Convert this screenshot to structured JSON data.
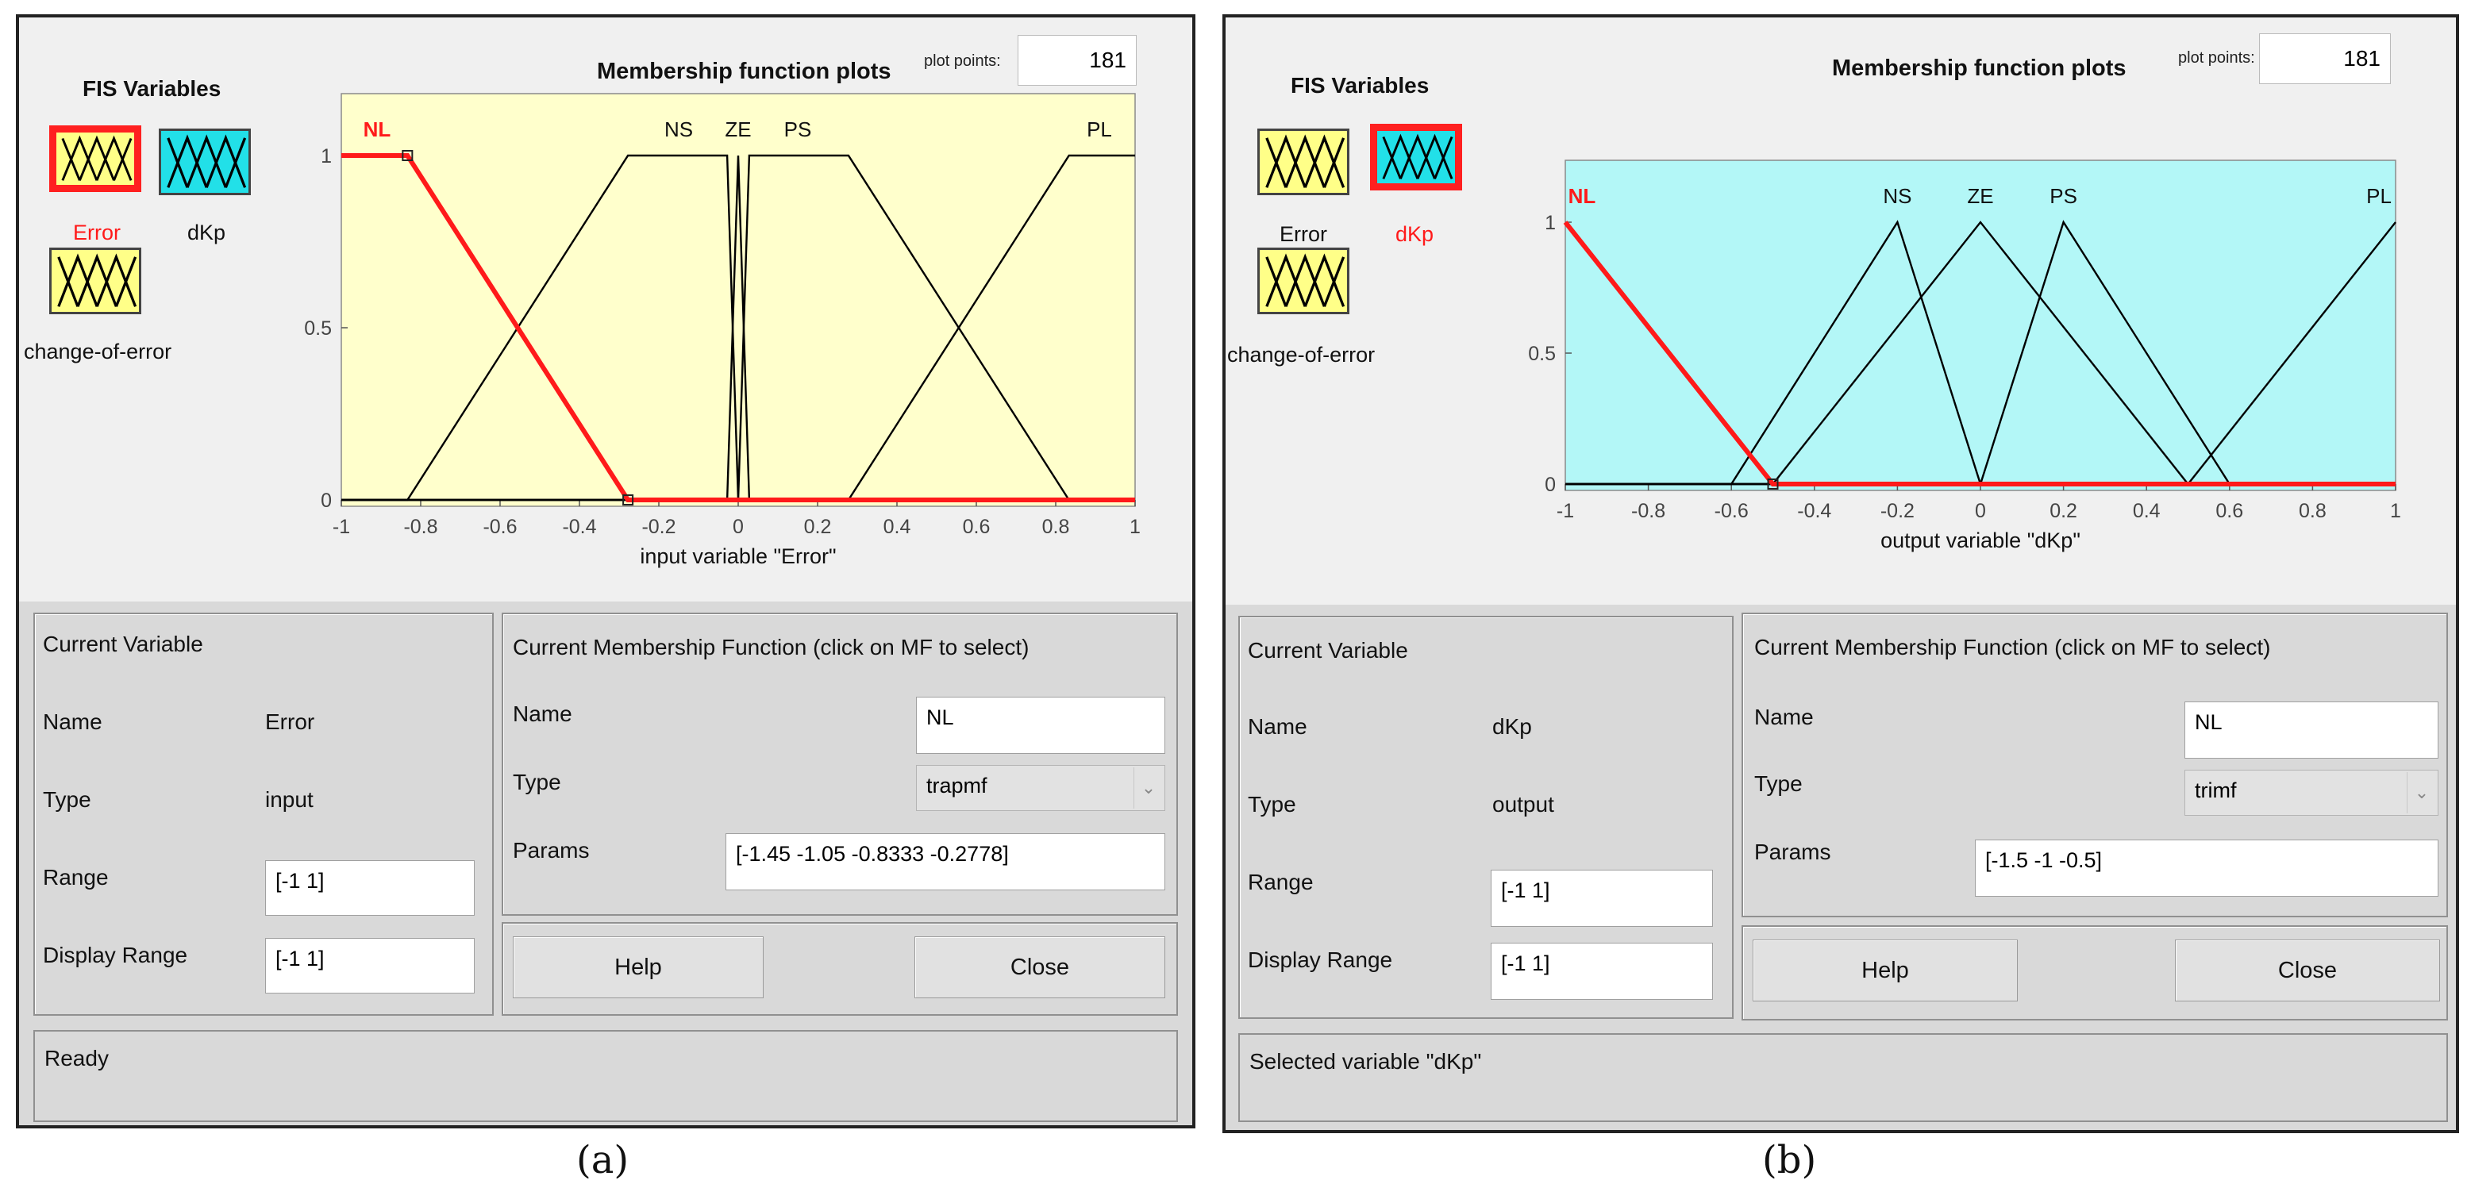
{
  "fis_variables_title": "FIS Variables",
  "plot_title": "Membership function plots",
  "plot_points_label": "plot points:",
  "panels": [
    {
      "caption": "(a)",
      "plot_bg": "#ffffcc",
      "plot_points": "181",
      "variables": {
        "error": "Error",
        "dkp": "dKp",
        "change_of_error": "change-of-error"
      },
      "selected_variable": "error",
      "chart_data": {
        "type": "line",
        "xlabel": "input variable \"Error\"",
        "xlim": [
          -1,
          1
        ],
        "ylim": [
          0,
          1
        ],
        "xticks": [
          "-1",
          "-0.8",
          "-0.6",
          "-0.4",
          "-0.2",
          "0",
          "0.2",
          "0.4",
          "0.6",
          "0.8",
          "1"
        ],
        "yticks": [
          "0",
          "0.5",
          "1"
        ],
        "series": [
          {
            "name": "NL",
            "selected": true,
            "points": [
              [
                -1,
                1
              ],
              [
                -0.8333,
                1
              ],
              [
                -0.2778,
                0
              ],
              [
                1,
                0
              ]
            ]
          },
          {
            "name": "NS",
            "selected": false,
            "points": [
              [
                -1,
                0
              ],
              [
                -0.8333,
                0
              ],
              [
                -0.2778,
                1
              ],
              [
                -0.0278,
                1
              ],
              [
                0,
                0
              ],
              [
                1,
                0
              ]
            ]
          },
          {
            "name": "ZE",
            "selected": false,
            "points": [
              [
                -1,
                0
              ],
              [
                -0.0278,
                0
              ],
              [
                0,
                1
              ],
              [
                0.0278,
                0
              ],
              [
                1,
                0
              ]
            ]
          },
          {
            "name": "PS",
            "selected": false,
            "points": [
              [
                -1,
                0
              ],
              [
                0,
                0
              ],
              [
                0.0278,
                1
              ],
              [
                0.2778,
                1
              ],
              [
                0.8333,
                0
              ],
              [
                1,
                0
              ]
            ]
          },
          {
            "name": "PL",
            "selected": false,
            "points": [
              [
                -1,
                0
              ],
              [
                0.2778,
                0
              ],
              [
                0.8333,
                1
              ],
              [
                1,
                1
              ]
            ]
          }
        ],
        "labels": [
          {
            "text": "NL",
            "x": -0.91
          },
          {
            "text": "NS",
            "x": -0.15
          },
          {
            "text": "ZE",
            "x": 0.0
          },
          {
            "text": "PS",
            "x": 0.15
          },
          {
            "text": "PL",
            "x": 0.91
          }
        ]
      },
      "current_variable": {
        "title": "Current Variable",
        "name_label": "Name",
        "name_value": "Error",
        "type_label": "Type",
        "type_value": "input",
        "range_label": "Range",
        "range_value": "[-1 1]",
        "display_range_label": "Display Range",
        "display_range_value": "[-1 1]"
      },
      "current_mf": {
        "title": "Current Membership Function (click on MF to select)",
        "name_label": "Name",
        "name_value": "NL",
        "type_label": "Type",
        "type_value": "trapmf",
        "params_label": "Params",
        "params_value": "[-1.45 -1.05 -0.8333 -0.2778]"
      },
      "help_label": "Help",
      "close_label": "Close",
      "status": "Ready"
    },
    {
      "caption": "(b)",
      "plot_bg": "#b3f7f7",
      "plot_points": "181",
      "variables": {
        "error": "Error",
        "dkp": "dKp",
        "change_of_error": "change-of-error"
      },
      "selected_variable": "dkp",
      "chart_data": {
        "type": "line",
        "xlabel": "output variable \"dKp\"",
        "xlim": [
          -1,
          1
        ],
        "ylim": [
          0,
          1
        ],
        "xticks": [
          "-1",
          "-0.8",
          "-0.6",
          "-0.4",
          "-0.2",
          "0",
          "0.2",
          "0.4",
          "0.6",
          "0.8",
          "1"
        ],
        "yticks": [
          "0",
          "0.5",
          "1"
        ],
        "series": [
          {
            "name": "NL",
            "selected": true,
            "points": [
              [
                -1,
                1
              ],
              [
                -0.5,
                0
              ],
              [
                1,
                0
              ]
            ]
          },
          {
            "name": "NS",
            "selected": false,
            "points": [
              [
                -1,
                0
              ],
              [
                -0.6,
                0
              ],
              [
                -0.2,
                1
              ],
              [
                0,
                0
              ],
              [
                1,
                0
              ]
            ]
          },
          {
            "name": "ZE",
            "selected": false,
            "points": [
              [
                -1,
                0
              ],
              [
                -0.5,
                0
              ],
              [
                0,
                1
              ],
              [
                0.5,
                0
              ],
              [
                1,
                0
              ]
            ]
          },
          {
            "name": "PS",
            "selected": false,
            "points": [
              [
                -1,
                0
              ],
              [
                0,
                0
              ],
              [
                0.2,
                1
              ],
              [
                0.6,
                0
              ],
              [
                1,
                0
              ]
            ]
          },
          {
            "name": "PL",
            "selected": false,
            "points": [
              [
                -1,
                0
              ],
              [
                0.5,
                0
              ],
              [
                1,
                1
              ]
            ]
          }
        ],
        "labels": [
          {
            "text": "NL",
            "x": -0.96
          },
          {
            "text": "NS",
            "x": -0.2
          },
          {
            "text": "ZE",
            "x": 0.0
          },
          {
            "text": "PS",
            "x": 0.2
          },
          {
            "text": "PL",
            "x": 0.96
          }
        ]
      },
      "current_variable": {
        "title": "Current Variable",
        "name_label": "Name",
        "name_value": "dKp",
        "type_label": "Type",
        "type_value": "output",
        "range_label": "Range",
        "range_value": "[-1 1]",
        "display_range_label": "Display Range",
        "display_range_value": "[-1 1]"
      },
      "current_mf": {
        "title": "Current Membership Function (click on MF to select)",
        "name_label": "Name",
        "name_value": "NL",
        "type_label": "Type",
        "type_value": "trimf",
        "params_label": "Params",
        "params_value": "[-1.5 -1 -0.5]"
      },
      "help_label": "Help",
      "close_label": "Close",
      "status": "Selected variable \"dKp\""
    }
  ]
}
